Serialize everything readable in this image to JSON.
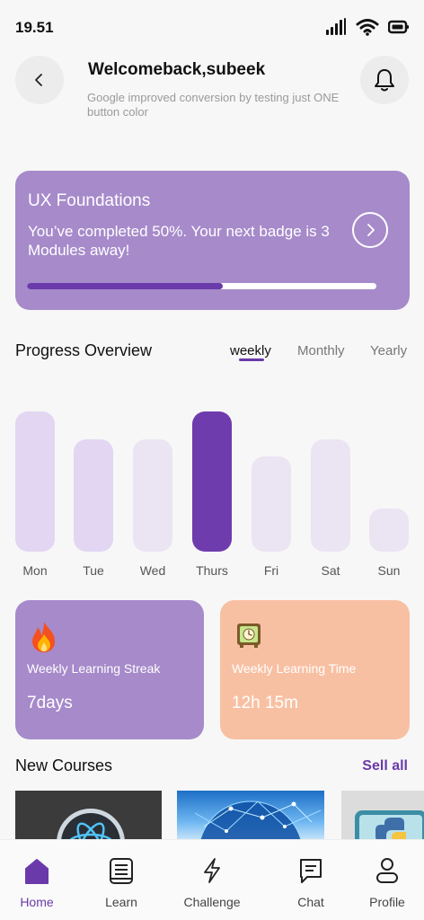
{
  "status": {
    "time": "19.51"
  },
  "header": {
    "title": "Welcomeback,subeek",
    "subtitle": "Google improved conversion by testing just ONE button color"
  },
  "course_card": {
    "title": "UX Foundations",
    "description": "You’ve completed 50%. Your next badge is 3 Modules away!",
    "progress": 0.56
  },
  "progress_overview": {
    "title": "Progress Overview",
    "tabs": [
      {
        "label": "weekly",
        "active": true
      },
      {
        "label": "Monthly",
        "active": false
      },
      {
        "label": "Yearly",
        "active": false
      }
    ]
  },
  "chart_data": {
    "type": "bar",
    "categories": [
      "Mon",
      "Tue",
      "Wed",
      "Thurs",
      "Fri",
      "Sat",
      "Sun"
    ],
    "values": [
      156,
      125,
      125,
      156,
      106,
      125,
      48
    ],
    "highlighted": "Thurs",
    "colors": {
      "Mon": "#e2d6f2",
      "Tue": "#e2d6f2",
      "Wed": "#ebe4f3",
      "Thurs": "#6f3cad",
      "Fri": "#ebe4f3",
      "Sat": "#ebe4f3",
      "Sun": "#ebe4f3"
    },
    "ylim": [
      0,
      156
    ]
  },
  "stats": {
    "streak": {
      "label": "Weekly Learning Streak",
      "value": "7days",
      "icon": "fire-icon"
    },
    "time": {
      "label": "Weekly Learning Time",
      "value": "12h 15m",
      "icon": "clock-icon"
    }
  },
  "new_courses": {
    "title": "New Courses",
    "see_all": "Sell all"
  },
  "nav": {
    "items": [
      {
        "label": "Home",
        "icon": "home-icon"
      },
      {
        "label": "Learn",
        "icon": "book-icon"
      },
      {
        "label": "Challenge",
        "icon": "lightning-icon"
      },
      {
        "label": "Chat",
        "icon": "chat-icon"
      },
      {
        "label": "Profile",
        "icon": "user-icon"
      }
    ]
  },
  "colors": {
    "accent": "#6a3aaa",
    "card_purple": "#a68aca",
    "card_peach": "#f8c0a3"
  }
}
